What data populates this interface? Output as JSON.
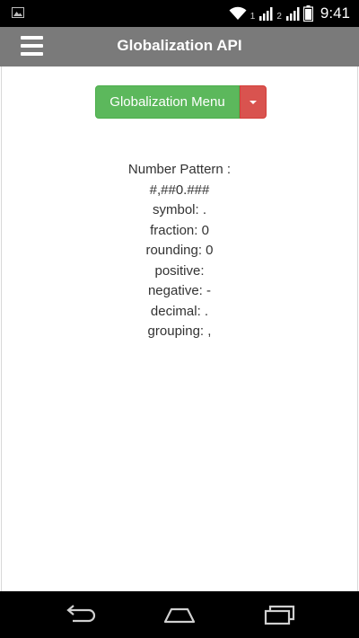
{
  "status_bar": {
    "sim1": "1",
    "sim2": "2",
    "time": "9:41"
  },
  "app_bar": {
    "title": "Globalization API"
  },
  "menu_button": {
    "label": "Globalization Menu"
  },
  "info": {
    "lines": [
      "Number Pattern :",
      "#,##0.###",
      "symbol: .",
      "fraction: 0",
      "rounding: 0",
      "positive:",
      "negative: -",
      "decimal: .",
      "grouping: ,"
    ]
  },
  "colors": {
    "app_bar": "#7a7a7a",
    "success_button": "#5cb85c",
    "danger_button": "#d9534f"
  },
  "icons": {
    "status_notification": "image-notification-icon",
    "wifi": "wifi-icon",
    "signal": "signal-icon",
    "battery": "battery-icon",
    "menu": "hamburger-menu-icon",
    "back": "back-icon",
    "home": "home-icon",
    "recents": "recents-icon"
  }
}
